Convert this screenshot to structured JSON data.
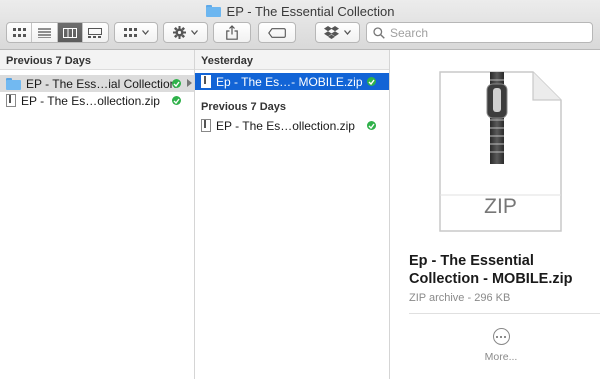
{
  "window": {
    "title": "EP - The Essential Collection"
  },
  "toolbar": {
    "view_modes": [
      "icon-view",
      "list-view",
      "column-view",
      "gallery-view"
    ],
    "active_view": "column-view",
    "search_placeholder": "Search"
  },
  "column1": {
    "header": "Previous 7 Days",
    "items": [
      {
        "name": "EP - The Ess…ial Collection",
        "type": "folder",
        "selected": true,
        "synced": true
      },
      {
        "name": "EP - The Es…ollection.zip",
        "type": "zip",
        "selected": false,
        "synced": true
      }
    ]
  },
  "column2": {
    "header": "Yesterday",
    "items_top": [
      {
        "name": "Ep - The Es…- MOBILE.zip",
        "type": "zip",
        "selected": true,
        "synced": true
      }
    ],
    "section_label": "Previous 7 Days",
    "items_bottom": [
      {
        "name": "EP - The Es…ollection.zip",
        "type": "zip",
        "selected": false,
        "synced": true
      }
    ]
  },
  "preview": {
    "icon_label": "ZIP",
    "file_name": "Ep - The Essential Collection - MOBILE.zip",
    "file_meta": "ZIP archive - 296 KB",
    "more_label": "More..."
  },
  "colors": {
    "selection_blue": "#1264d6",
    "sync_green": "#2fb14a",
    "folder_blue": "#72b9f1"
  }
}
